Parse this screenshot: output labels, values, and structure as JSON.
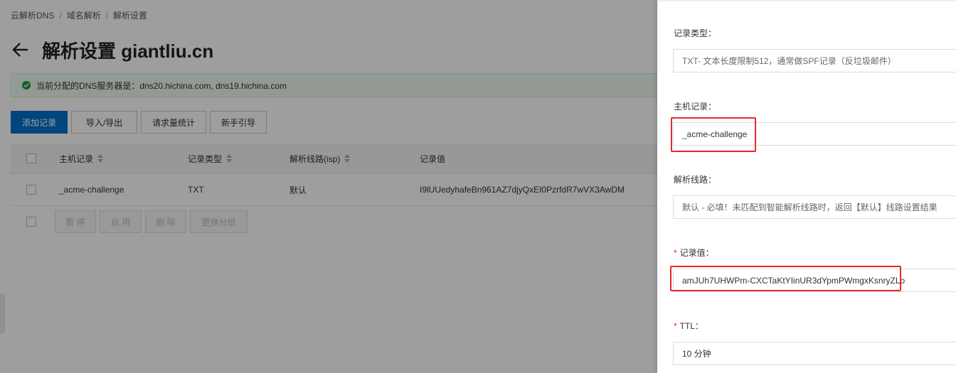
{
  "breadcrumb": [
    "云解析DNS",
    "域名解析",
    "解析设置"
  ],
  "page_title": "解析设置 giantliu.cn",
  "notice_text": "当前分配的DNS服务器是：dns20.hichina.com, dns19.hichina.com",
  "toolbar": {
    "add": "添加记录",
    "import_export": "导入/导出",
    "stats": "请求量统计",
    "guide": "新手引导"
  },
  "table": {
    "columns": [
      "主机记录",
      "记录类型",
      "解析线路(isp)",
      "记录值"
    ],
    "rows": [
      {
        "host": "_acme-challenge",
        "type": "TXT",
        "line": "默认",
        "value": "I9lUUedyhafeBn961AZ7djyQxEI0PzrfdR7wVX3AwDM"
      }
    ]
  },
  "bulk_actions": [
    "暂 停",
    "启 用",
    "删 除",
    "更换分组"
  ],
  "form": {
    "record_type_label": "记录类型：",
    "record_type_value": "TXT- 文本长度限制512，通常做SPF记录（反垃圾邮件）",
    "host_label": "主机记录：",
    "host_value": "_acme-challenge",
    "line_label": "解析线路：",
    "line_value": "默认 - 必填！未匹配到智能解析线路时，返回【默认】线路设置结果",
    "value_label": "记录值：",
    "value_value": "amJUh7UHWPm-CXCTaKtYIinUR3dYpmPWmgxKsnryZLo",
    "ttl_label": "TTL：",
    "ttl_value": "10 分钟",
    "required_mark": "*"
  },
  "colors": {
    "primary": "#0070cc",
    "highlight": "#e7282c",
    "success": "#1e9c3e",
    "required": "#e62a10"
  }
}
